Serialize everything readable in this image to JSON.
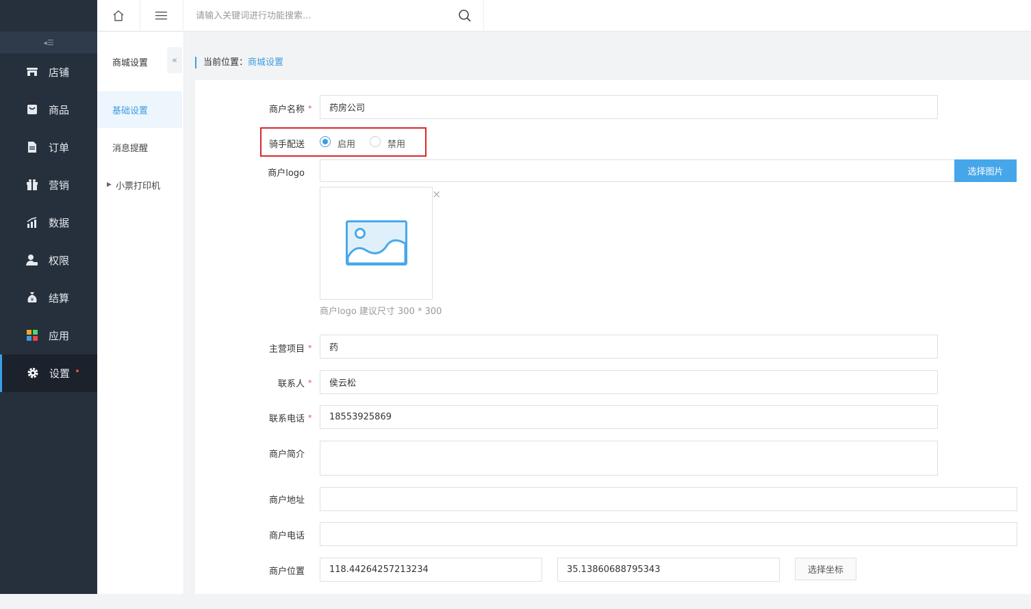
{
  "sidebar": {
    "items": [
      {
        "label": "店铺",
        "icon": "shop-icon"
      },
      {
        "label": "商品",
        "icon": "bag-icon"
      },
      {
        "label": "订单",
        "icon": "document-icon"
      },
      {
        "label": "营销",
        "icon": "gift-icon"
      },
      {
        "label": "数据",
        "icon": "bar-chart-icon"
      },
      {
        "label": "权限",
        "icon": "user-lock-icon"
      },
      {
        "label": "结算",
        "icon": "money-bag-icon"
      },
      {
        "label": "应用",
        "icon": "apps-grid-icon"
      },
      {
        "label": "设置",
        "icon": "gear-icon"
      }
    ],
    "collapse_glyph": "◂☰"
  },
  "topbar": {
    "search_placeholder": "请输入关键词进行功能搜索..."
  },
  "submenu": {
    "title": "商城设置",
    "collapse_glyph": "«",
    "items": [
      {
        "label": "基础设置"
      },
      {
        "label": "消息提醒"
      },
      {
        "label": "小票打印机"
      }
    ]
  },
  "breadcrumb": {
    "prefix": "当前位置：",
    "current": "商城设置"
  },
  "form": {
    "merchant_name": {
      "label": "商户名称",
      "value": "药房公司",
      "required": "*"
    },
    "rider_delivery": {
      "label": "骑手配送",
      "options": [
        "启用",
        "禁用"
      ],
      "selected": "启用"
    },
    "logo": {
      "label": "商户logo",
      "button": "选择图片",
      "close": "×",
      "hint": "商户logo 建议尺寸 300 * 300"
    },
    "main_business": {
      "label": "主营项目",
      "value": "药",
      "required": "*"
    },
    "contact": {
      "label": "联系人",
      "value": "侯云松",
      "required": "*"
    },
    "phone": {
      "label": "联系电话",
      "value": "18553925869",
      "required": "*"
    },
    "intro": {
      "label": "商户简介",
      "value": ""
    },
    "address": {
      "label": "商户地址",
      "value": ""
    },
    "merchant_phone": {
      "label": "商户电话",
      "value": ""
    },
    "location": {
      "label": "商户位置",
      "longitude": "118.44264257213234",
      "latitude": "35.13860688795343",
      "button": "选择坐标"
    }
  },
  "colors": {
    "sidebar_bg": "#26303d",
    "accent": "#3d9de3",
    "highlight": "#d9262b",
    "required": "#e5484d"
  }
}
